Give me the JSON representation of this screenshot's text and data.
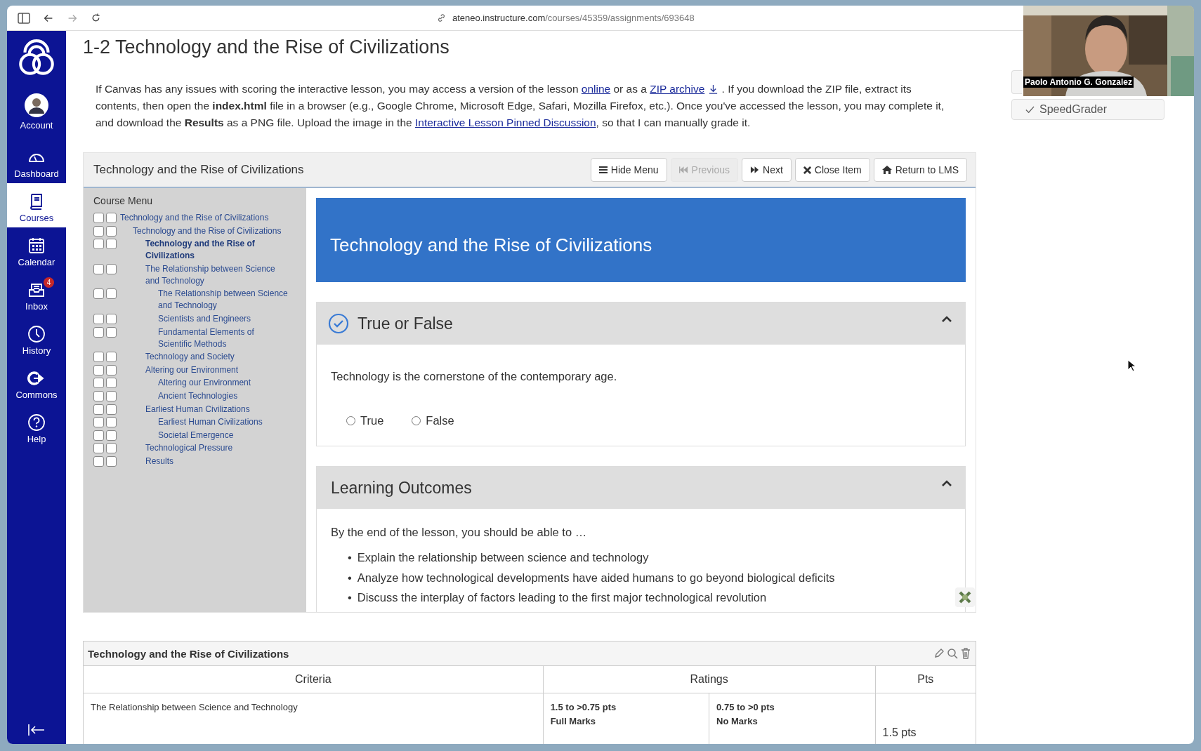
{
  "browser": {
    "address": "**ateneo.instructure.com**/courses/45359/assignments/693648"
  },
  "sidebar": {
    "items": [
      {
        "kind": "account",
        "label": "Account",
        "selected": false
      },
      {
        "kind": "dashboard",
        "label": "Dashboard",
        "selected": false
      },
      {
        "kind": "courses",
        "label": "Courses",
        "selected": true
      },
      {
        "kind": "calendar",
        "label": "Calendar",
        "selected": false
      },
      {
        "kind": "inbox",
        "label": "Inbox",
        "selected": false,
        "badge": "4"
      },
      {
        "kind": "history",
        "label": "History",
        "selected": false
      },
      {
        "kind": "commons",
        "label": "Commons",
        "selected": false
      },
      {
        "kind": "help",
        "label": "Help",
        "selected": false
      }
    ]
  },
  "page_title": "1-2 Technology and the Rise of Civilizations",
  "intro": [
    {
      "kind": "text",
      "text": "If Canvas has any issues with scoring the interactive lesson, you may access a version of the lesson "
    },
    {
      "kind": "link",
      "text": "online"
    },
    {
      "kind": "text",
      "text": " or as a "
    },
    {
      "kind": "link",
      "text": "ZIP archive",
      "download": true
    },
    {
      "kind": "text",
      "text": " . If you download the ZIP file, extract its contents, then open the "
    },
    {
      "kind": "bold",
      "text": "index.html"
    },
    {
      "kind": "text",
      "text": " file in a browser (e.g., Google Chrome, Microsoft Edge, Safari, Mozilla Firefox, etc.). Once you've accessed the lesson, you may complete it, and download the "
    },
    {
      "kind": "bold",
      "text": "Results"
    },
    {
      "kind": "text",
      "text": " as a PNG file. Upload the image in the "
    },
    {
      "kind": "link",
      "text": "Interactive Lesson Pinned Discussion"
    },
    {
      "kind": "text",
      "text": ", so that I can manually grade it."
    }
  ],
  "lesson": {
    "title": "Technology and the Rise of Civilizations",
    "buttons": [
      {
        "kind": "menu",
        "label": "Hide Menu",
        "disabled": false
      },
      {
        "kind": "previous",
        "label": "Previous",
        "disabled": true
      },
      {
        "kind": "next",
        "label": "Next",
        "disabled": false
      },
      {
        "kind": "close",
        "label": "Close Item",
        "disabled": false
      },
      {
        "kind": "home",
        "label": "Return to LMS",
        "disabled": false
      }
    ],
    "menu": {
      "title": "Course Menu",
      "items": [
        {
          "label": "Technology and the Rise of Civilizations",
          "selected": false,
          "checked": false,
          "completed": false,
          "children": [
            {
              "label": "Technology and the Rise of Civilizations",
              "selected": false,
              "checked": false,
              "completed": false,
              "children": [
                {
                  "label": "Technology and the Rise of Civilizations",
                  "selected": true,
                  "checked": false,
                  "completed": false
                },
                {
                  "label": "The Relationship between Science and Technology",
                  "selected": false,
                  "checked": false,
                  "completed": false,
                  "children": [
                    {
                      "label": "The Relationship between Science and Technology",
                      "selected": false,
                      "checked": false,
                      "completed": false
                    },
                    {
                      "label": "Scientists and Engineers",
                      "selected": false,
                      "checked": false,
                      "completed": false
                    },
                    {
                      "label": "Fundamental Elements of Scientific Methods",
                      "selected": false,
                      "checked": false,
                      "completed": false
                    }
                  ]
                },
                {
                  "label": "Technology and Society",
                  "selected": false,
                  "checked": false,
                  "completed": false
                },
                {
                  "label": "Altering our Environment",
                  "selected": false,
                  "checked": false,
                  "completed": false,
                  "children": [
                    {
                      "label": "Altering our Environment",
                      "selected": false,
                      "checked": false,
                      "completed": false
                    },
                    {
                      "label": "Ancient Technologies",
                      "selected": false,
                      "checked": false,
                      "completed": false
                    }
                  ]
                },
                {
                  "label": "Earliest Human Civilizations",
                  "selected": false,
                  "checked": false,
                  "completed": false,
                  "children": [
                    {
                      "label": "Earliest Human Civilizations",
                      "selected": false,
                      "checked": false,
                      "completed": false
                    },
                    {
                      "label": "Societal Emergence",
                      "selected": false,
                      "checked": false,
                      "completed": false
                    }
                  ]
                },
                {
                  "label": "Technological Pressure",
                  "selected": false,
                  "checked": false,
                  "completed": false
                },
                {
                  "label": "Results",
                  "selected": false,
                  "checked": false,
                  "completed": false
                }
              ]
            }
          ]
        }
      ]
    },
    "banner": "Technology and the Rise of Civilizations",
    "marker": "•",
    "panels": [
      {
        "kind": "question",
        "title": "True or False",
        "expanded": true,
        "done": true,
        "question": "Technology is the cornerstone of the contemporary age.",
        "options": [
          {
            "label": "True",
            "selected": false
          },
          {
            "label": "False",
            "selected": false
          }
        ]
      },
      {
        "kind": "outcomes",
        "title": "Learning Outcomes",
        "expanded": true,
        "intro": "By the end of the lesson, you should be able to …",
        "bullets": [
          "Explain the relationship between science and technology",
          "Analyze how technological developments have aided humans to go beyond biological deficits",
          "Discuss the interplay of factors leading to the first major technological revolution"
        ]
      }
    ]
  },
  "speedgrader": {
    "label": "SpeedGrader"
  },
  "rubric": {
    "title": "Technology and the Rise of Civilizations",
    "columns": [
      "Criteria",
      "Ratings",
      "Pts"
    ],
    "rows": [
      {
        "criterion": "The Relationship between Science and Technology",
        "ratings": [
          {
            "range": "1.5 to >0.75 pts",
            "label": "Full Marks"
          },
          {
            "range": "0.75 to >0 pts",
            "label": "No Marks"
          }
        ],
        "points": "1.5 pts"
      }
    ]
  },
  "video": {
    "kind": "picture",
    "name": "Paolo Antonio G. Gonzalez"
  }
}
